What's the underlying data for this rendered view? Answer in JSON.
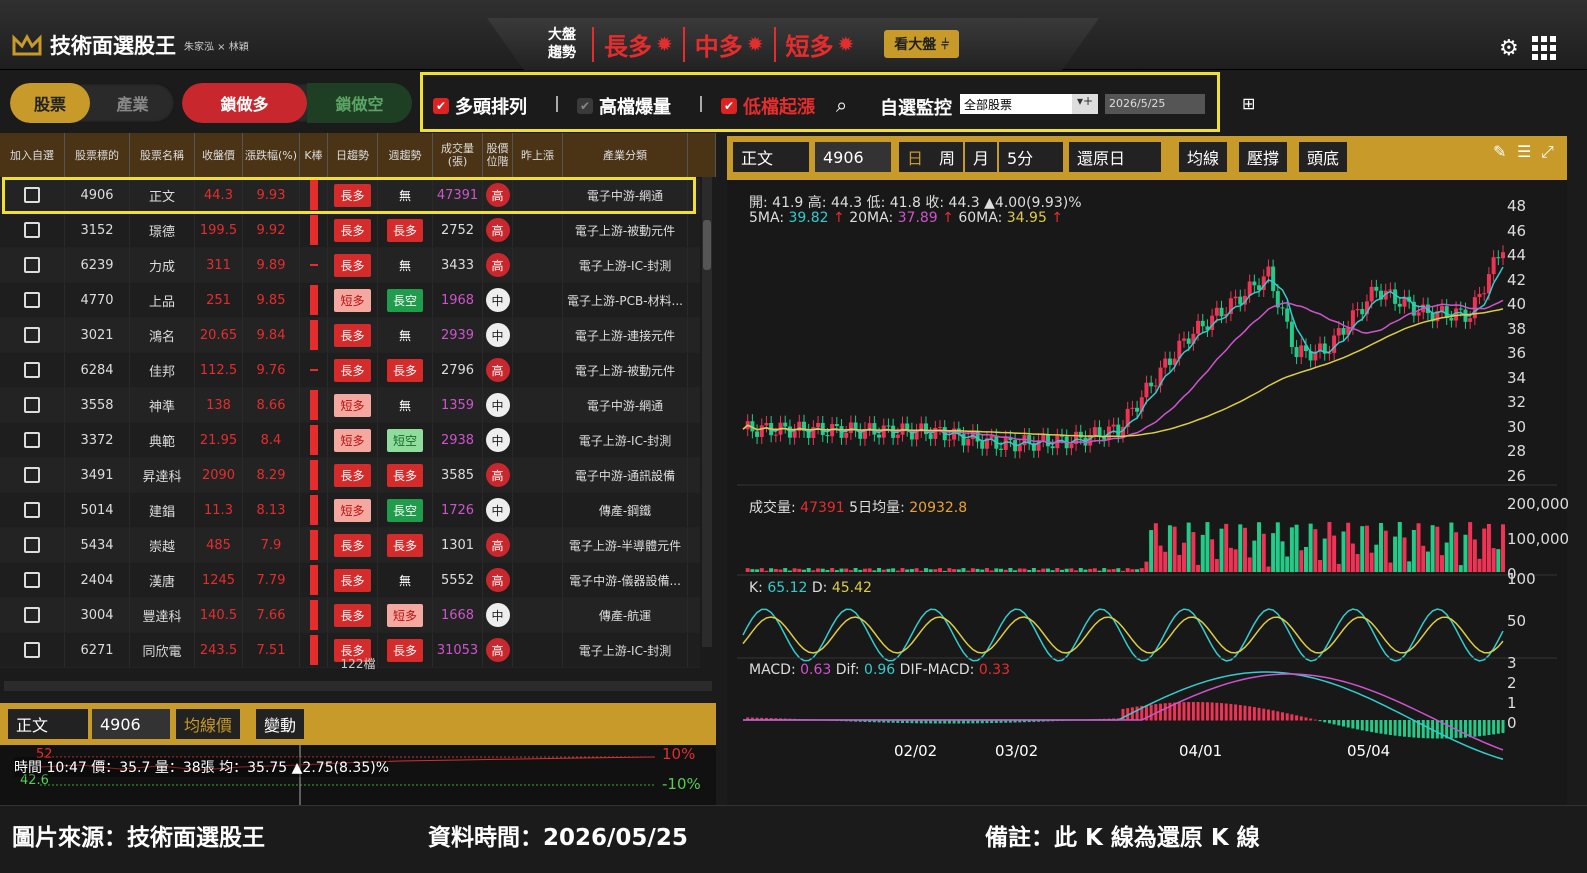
{
  "app": {
    "title": "技術面選股王",
    "authors": "朱家泓 × 林穎"
  },
  "trend": {
    "label": "大盤趨勢",
    "long": "長多",
    "mid": "中多",
    "short": "短多",
    "view_button": "看大盤"
  },
  "toggles": {
    "stock": "股票",
    "industry": "產業",
    "lock_long": "鎖做多",
    "lock_short": "鎖做空"
  },
  "filters": {
    "bull_align": "多頭排列",
    "high_volume": "高檔爆量",
    "low_rise": "低檔起漲",
    "watch_label": "自選監控",
    "watch_value": "全部股票",
    "date_value": "2026/5/25"
  },
  "table": {
    "headers": [
      "加入自選",
      "股票標的",
      "股票名稱",
      "收盤價",
      "漲跌幅(%)",
      "K棒",
      "日趨勢",
      "週趨勢",
      "成交量(張)",
      "股價位階",
      "昨上漲",
      "產業分類"
    ],
    "rows": [
      {
        "code": "4906",
        "name": "正文",
        "close": "44.3",
        "chg": "9.93",
        "daily": "長多",
        "weekly": "無",
        "vol": "47391",
        "pos": "高",
        "industry": "電子中游-網通"
      },
      {
        "code": "3152",
        "name": "璟德",
        "close": "199.5",
        "chg": "9.92",
        "daily": "長多",
        "weekly": "長多",
        "vol": "2752",
        "pos": "高",
        "industry": "電子上游-被動元件"
      },
      {
        "code": "6239",
        "name": "力成",
        "close": "311",
        "chg": "9.89",
        "daily": "長多",
        "weekly": "無",
        "vol": "3433",
        "pos": "高",
        "industry": "電子上游-IC-封測"
      },
      {
        "code": "4770",
        "name": "上品",
        "close": "251",
        "chg": "9.85",
        "daily": "短多",
        "weekly": "長空",
        "vol": "1968",
        "pos": "中",
        "industry": "電子上游-PCB-材料..."
      },
      {
        "code": "3021",
        "name": "鴻名",
        "close": "20.65",
        "chg": "9.84",
        "daily": "長多",
        "weekly": "無",
        "vol": "2939",
        "pos": "中",
        "industry": "電子上游-連接元件"
      },
      {
        "code": "6284",
        "name": "佳邦",
        "close": "112.5",
        "chg": "9.76",
        "daily": "長多",
        "weekly": "長多",
        "vol": "2796",
        "pos": "高",
        "industry": "電子上游-被動元件"
      },
      {
        "code": "3558",
        "name": "神準",
        "close": "138",
        "chg": "8.66",
        "daily": "短多",
        "weekly": "無",
        "vol": "1359",
        "pos": "中",
        "industry": "電子中游-網通"
      },
      {
        "code": "3372",
        "name": "典範",
        "close": "21.95",
        "chg": "8.4",
        "daily": "短多",
        "weekly": "短空",
        "vol": "2938",
        "pos": "中",
        "industry": "電子上游-IC-封測"
      },
      {
        "code": "3491",
        "name": "昇達科",
        "close": "2090",
        "chg": "8.29",
        "daily": "長多",
        "weekly": "長多",
        "vol": "3585",
        "pos": "高",
        "industry": "電子中游-通訊設備"
      },
      {
        "code": "5014",
        "name": "建錩",
        "close": "11.3",
        "chg": "8.13",
        "daily": "短多",
        "weekly": "長空",
        "vol": "1726",
        "pos": "中",
        "industry": "傳產-鋼鐵"
      },
      {
        "code": "5434",
        "name": "崇越",
        "close": "485",
        "chg": "7.9",
        "daily": "長多",
        "weekly": "長多",
        "vol": "1301",
        "pos": "高",
        "industry": "電子上游-半導體元件"
      },
      {
        "code": "2404",
        "name": "漢唐",
        "close": "1245",
        "chg": "7.79",
        "daily": "長多",
        "weekly": "無",
        "vol": "5552",
        "pos": "高",
        "industry": "電子中游-儀器設備..."
      },
      {
        "code": "3004",
        "name": "豐達科",
        "close": "140.5",
        "chg": "7.66",
        "daily": "長多",
        "weekly": "短多",
        "vol": "1668",
        "pos": "中",
        "industry": "傳產-航運"
      },
      {
        "code": "6271",
        "name": "同欣電",
        "close": "243.5",
        "chg": "7.51",
        "daily": "長多",
        "weekly": "長多",
        "vol": "31053",
        "pos": "高",
        "industry": "電子上游-IC-封測"
      }
    ],
    "count": "122檔"
  },
  "bottom_left": {
    "name": "正文",
    "code": "4906",
    "btn1": "均線價",
    "btn2": "變動",
    "tick_line": "時間 10:47 價：35.7 量：38張 均：35.75 ▲2.75(8.35)%",
    "pct_up": "10%",
    "pct_down": "-10%",
    "p_top": "52",
    "p_mid": "42.6"
  },
  "chart": {
    "name": "正文",
    "code": "4906",
    "periods": [
      "日",
      "周",
      "月"
    ],
    "interval": "5分",
    "adjust": "還原日",
    "buttons": [
      "均線",
      "壓撐",
      "頭底"
    ],
    "ohlc": "開: 41.9 高: 44.3 低: 41.8 收: 44.3 ▲4.00(9.93)%",
    "ma": {
      "ma5": "39.82",
      "ma20": "37.89",
      "ma60": "34.95"
    },
    "volume": {
      "vol": "47391",
      "avg5": "20932.8"
    },
    "kd": {
      "k": "65.12",
      "d": "45.42"
    },
    "macd": {
      "macd": "0.63",
      "dif": "0.96",
      "difmacd": "0.33"
    },
    "xlabels": [
      "02/02",
      "03/02",
      "04/01",
      "05/04"
    ],
    "price_ticks": [
      "48",
      "46",
      "44",
      "42",
      "40",
      "38",
      "36",
      "34",
      "32",
      "30",
      "28",
      "26"
    ],
    "vol_ticks": [
      "200,000",
      "100,000",
      "0"
    ],
    "kd_ticks": [
      "100",
      "50"
    ],
    "macd_ticks": [
      "3",
      "2",
      "1",
      "0"
    ]
  },
  "chart_data": {
    "type": "candlestick",
    "x_ticks": [
      "02/02",
      "03/02",
      "04/01",
      "05/04"
    ],
    "ylim": [
      25,
      48
    ],
    "last": {
      "open": 41.9,
      "high": 44.3,
      "low": 41.8,
      "close": 44.3
    },
    "ma5": 39.82,
    "ma20": 37.89,
    "ma60": 34.95
  },
  "footer": {
    "source": "圖片來源：技術面選股王",
    "time": "資料時間：2026/05/25",
    "note": "備註：此 K 線為還原 K 線"
  }
}
